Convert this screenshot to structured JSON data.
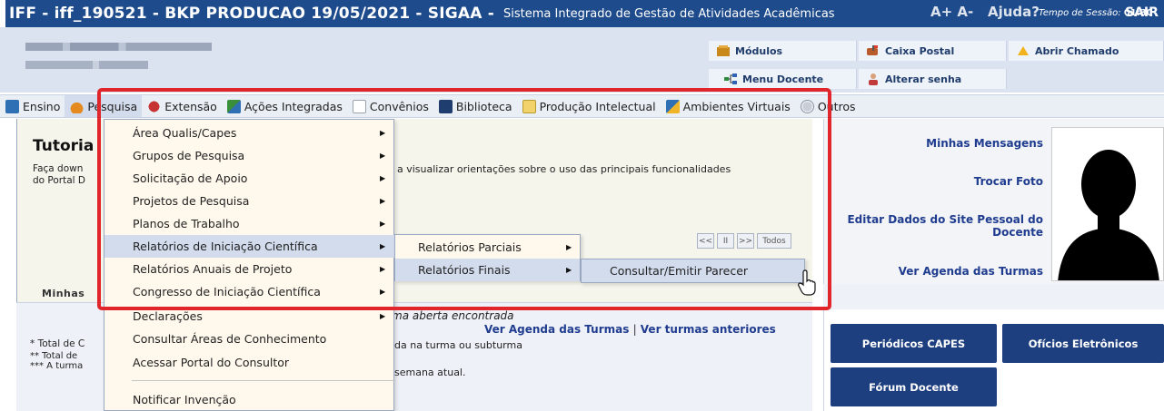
{
  "titlebar": {
    "main": "IFF - iff_190521 - BKP PRODUCAO 19/05/2021 - SIGAA -",
    "subtitle": "Sistema Integrado de Gestão de Atividades Acadêmicas",
    "font_size_label": "A+ A-",
    "ajuda": "Ajuda?",
    "session_label": "Tempo de Sessão:",
    "session_time": "01:30",
    "exit": "SAIR"
  },
  "header": {
    "buttons": {
      "modulos": "Módulos",
      "caixa_postal": "Caixa Postal",
      "abrir_chamado": "Abrir Chamado",
      "menu_docente": "Menu Docente",
      "alterar_senha": "Alterar senha"
    }
  },
  "menubar": {
    "items": [
      {
        "label": "Ensino",
        "icon": "ensino-icon"
      },
      {
        "label": "Pesquisa",
        "icon": "pesquisa-icon"
      },
      {
        "label": "Extensão",
        "icon": "extensao-icon"
      },
      {
        "label": "Ações Integradas",
        "icon": "acoes-icon"
      },
      {
        "label": "Convênios",
        "icon": "convenios-icon"
      },
      {
        "label": "Biblioteca",
        "icon": "biblioteca-icon"
      },
      {
        "label": "Produção Intelectual",
        "icon": "producao-icon"
      },
      {
        "label": "Ambientes Virtuais",
        "icon": "ambientes-icon"
      },
      {
        "label": "Outros",
        "icon": "outros-icon"
      }
    ]
  },
  "tutorial": {
    "title": "Tutoria",
    "text_line1": "Faça down",
    "text_line2": "do Portal D",
    "text_right": "a visualizar orientações sobre o uso das principais funcionalidades"
  },
  "pager": {
    "prev": "<<",
    "pause": "II",
    "next": ">>",
    "all": "Todos"
  },
  "turmas": {
    "section_label": "Minhas",
    "empty_message": "ma aberta encontrada",
    "link_agenda": "Ver Agenda das Turmas",
    "link_separator": "|",
    "link_anteriores": "Ver turmas anteriores",
    "foot1": "* Total de C",
    "foot2": "** Total de",
    "foot3": "*** A turma",
    "foot_right1": "da na turma ou subturma",
    "foot_right2": "semana atual."
  },
  "right_panel": {
    "mensagens": "Minhas Mensagens",
    "trocar_foto": "Trocar Foto",
    "editar_line1": "Editar Dados do Site Pessoal do",
    "editar_line2": "Docente",
    "agenda": "Ver Agenda das Turmas",
    "btn_capes": "Periódicos CAPES",
    "btn_oficios": "Ofícios Eletrônicos",
    "btn_forum": "Fórum Docente"
  },
  "dropdown": {
    "items": [
      {
        "label": "Área Qualis/Capes",
        "has_submenu": true
      },
      {
        "label": "Grupos de Pesquisa",
        "has_submenu": true
      },
      {
        "label": "Solicitação de Apoio",
        "has_submenu": true
      },
      {
        "label": "Projetos de Pesquisa",
        "has_submenu": true
      },
      {
        "label": "Planos de Trabalho",
        "has_submenu": true
      },
      {
        "label": "Relatórios de Iniciação Científica",
        "has_submenu": true
      },
      {
        "label": "Relatórios Anuais de Projeto",
        "has_submenu": true
      },
      {
        "label": "Congresso de Iniciação Científica",
        "has_submenu": true
      },
      {
        "label": "Declarações",
        "has_submenu": true
      },
      {
        "label": "Consultar Áreas de Conhecimento",
        "has_submenu": false
      },
      {
        "label": "Acessar Portal do Consultor",
        "has_submenu": false
      },
      {
        "label": "Notificar Invenção",
        "has_submenu": false
      }
    ],
    "submenu1": [
      "Relatórios Parciais",
      "Relatórios Finais"
    ],
    "submenu2": [
      "Consultar/Emitir Parecer"
    ]
  },
  "colors": {
    "titlebar": "#1e4b8c",
    "highlight": "#d2dced",
    "annotation_red": "#e0262a",
    "link_blue": "#1f3c8f",
    "button_blue": "#1d3f7f"
  }
}
